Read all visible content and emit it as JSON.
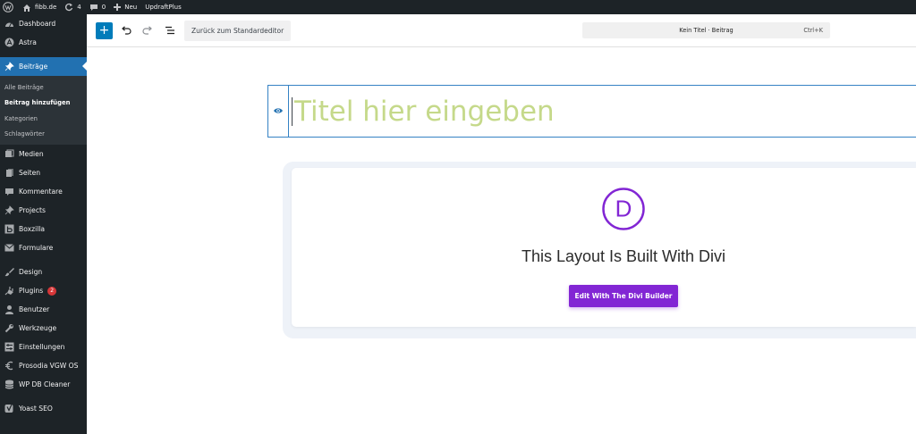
{
  "adminbar": {
    "site_name": "fibb.de",
    "updates_count": "4",
    "comments_count": "0",
    "new_label": "Neu",
    "plugin_label": "UpdraftPlus"
  },
  "sidebar": {
    "items": [
      {
        "label": "Dashboard",
        "icon": "dashboard-icon"
      },
      {
        "label": "Astra",
        "icon": "astra-icon"
      },
      {
        "label": "Beiträge",
        "icon": "pin-icon",
        "active": true
      },
      {
        "label": "Medien",
        "icon": "media-icon"
      },
      {
        "label": "Seiten",
        "icon": "pages-icon"
      },
      {
        "label": "Kommentare",
        "icon": "comment-icon"
      },
      {
        "label": "Projects",
        "icon": "pin-icon"
      },
      {
        "label": "Boxzilla",
        "icon": "boxzilla-icon"
      },
      {
        "label": "Formulare",
        "icon": "mail-icon"
      },
      {
        "label": "Design",
        "icon": "brush-icon"
      },
      {
        "label": "Plugins",
        "icon": "plugin-icon",
        "badge": "2"
      },
      {
        "label": "Benutzer",
        "icon": "user-icon"
      },
      {
        "label": "Werkzeuge",
        "icon": "wrench-icon"
      },
      {
        "label": "Einstellungen",
        "icon": "settings-icon"
      },
      {
        "label": "Prosodia VGW OS",
        "icon": "euro-icon"
      },
      {
        "label": "WP DB Cleaner",
        "icon": "database-icon"
      },
      {
        "label": "Yoast SEO",
        "icon": "yoast-icon"
      }
    ],
    "submenu": [
      {
        "label": "Alle Beiträge"
      },
      {
        "label": "Beitrag hinzufügen",
        "current": true
      },
      {
        "label": "Kategorien"
      },
      {
        "label": "Schlagwörter"
      }
    ]
  },
  "toolbar": {
    "add_label": "+",
    "back_label": "Zurück zum Standardeditor",
    "command_label": "Kein Titel · Beitrag",
    "command_shortcut": "Ctrl+K"
  },
  "editor": {
    "title_placeholder": "Titel hier eingeben"
  },
  "divi": {
    "logo_letter": "D",
    "heading": "This Layout Is Built With Divi",
    "button_label": "Edit With The Divi Builder"
  },
  "colors": {
    "admin_bg": "#1d2327",
    "active_blue": "#2271b1",
    "divi_purple": "#8226d4",
    "title_placeholder": "#c5d98a",
    "notification_red": "#d63638"
  }
}
